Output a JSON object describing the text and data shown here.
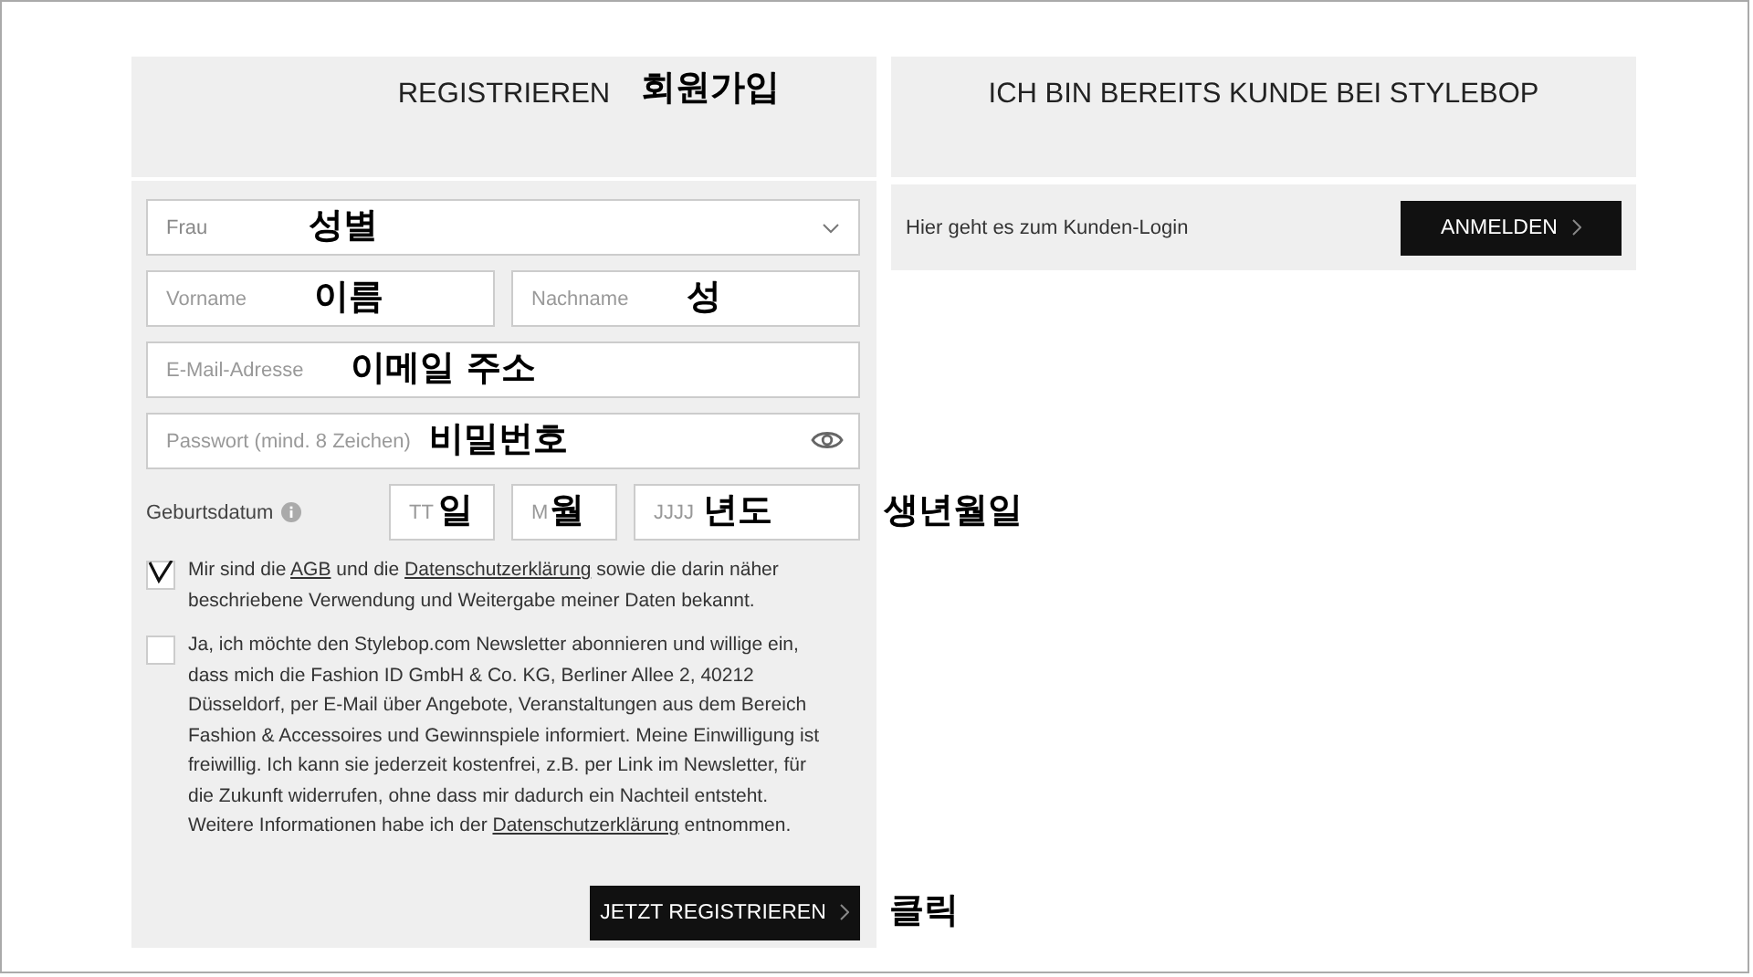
{
  "register": {
    "title": "REGISTRIEREN",
    "title_note": "회원가입",
    "gender": {
      "value": "Frau",
      "note": "성별"
    },
    "name_fields": [
      {
        "placeholder": "Vorname",
        "note": "이름"
      },
      {
        "placeholder": "Nachname",
        "note": "성"
      }
    ],
    "email": {
      "placeholder": "E-Mail-Adresse",
      "note": "이메일 주소"
    },
    "password": {
      "placeholder": "Passwort (mind. 8 Zeichen)",
      "note": "비밀번호"
    },
    "birthdate": {
      "label": "Geburtsdatum",
      "note": "생년월일",
      "fields": [
        {
          "placeholder": "TT",
          "note": "일"
        },
        {
          "placeholder": "M",
          "note": "월"
        },
        {
          "placeholder": "JJJJ",
          "note": "년도"
        }
      ]
    },
    "consents": [
      {
        "checked": true,
        "parts": [
          {
            "kind": "text",
            "text": "Mir sind die "
          },
          {
            "kind": "link",
            "text": "AGB"
          },
          {
            "kind": "text",
            "text": " und die "
          },
          {
            "kind": "link",
            "text": "Datenschutzerklärung"
          },
          {
            "kind": "text",
            "text": " sowie die darin näher beschriebene Verwendung und Weitergabe meiner Daten bekannt."
          }
        ]
      },
      {
        "checked": false,
        "parts": [
          {
            "kind": "text",
            "text": "Ja, ich möchte den Stylebop.com Newsletter abonnieren und willige ein, dass mich die Fashion ID GmbH & Co. KG, Berliner Allee 2, 40212 Düsseldorf, per E-Mail über Angebote, Veranstaltungen aus dem Bereich Fashion & Accessoires und Gewinnspiele informiert. Meine Einwilligung ist freiwillig. Ich kann sie jederzeit kostenfrei, z.B. per Link im Newsletter, für die Zukunft widerrufen, ohne dass mir dadurch ein Nachteil entsteht. Weitere Informationen habe ich der "
          },
          {
            "kind": "link",
            "text": "Datenschutzerklärung"
          },
          {
            "kind": "text",
            "text": " entnommen."
          }
        ]
      }
    ],
    "submit": {
      "label": "JETZT REGISTRIEREN",
      "note": "클릭"
    }
  },
  "login": {
    "title": "ICH BIN BEREITS KUNDE BEI STYLEBOP",
    "text": "Hier geht es zum Kunden-Login",
    "button": "ANMELDEN"
  }
}
